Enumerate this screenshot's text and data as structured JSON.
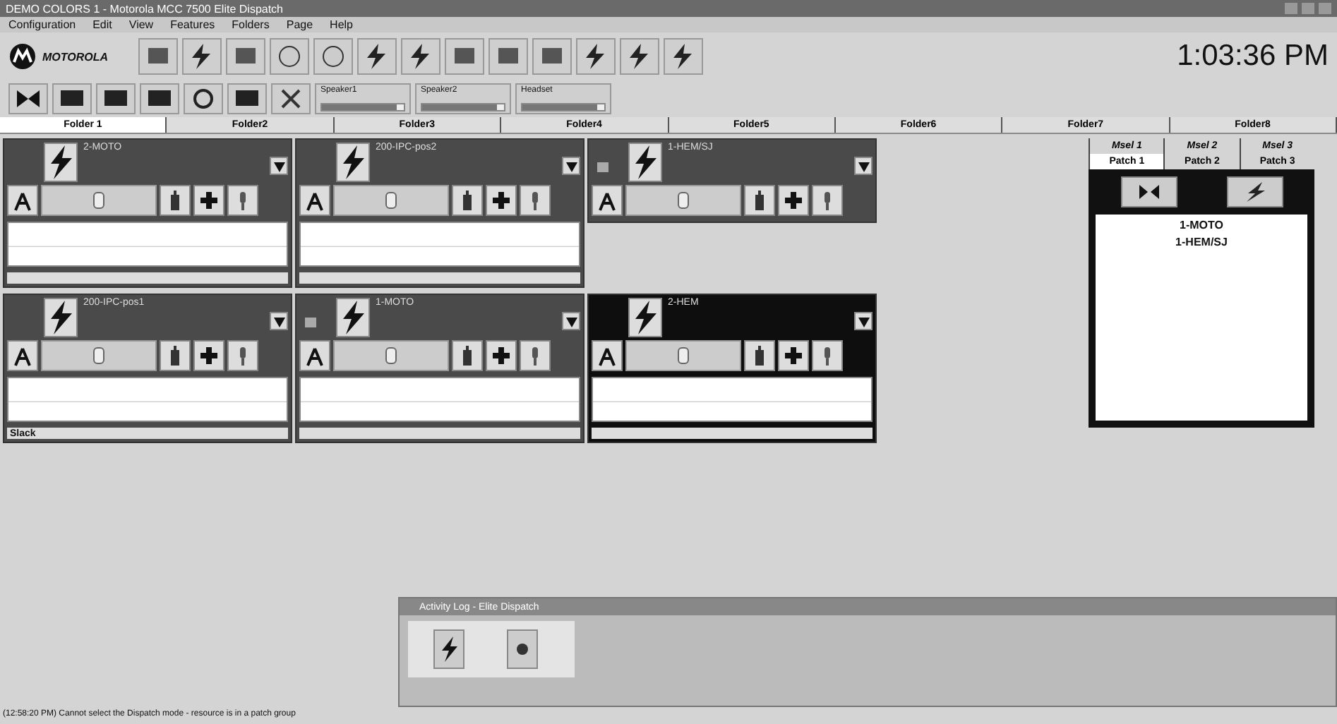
{
  "window": {
    "title": "DEMO COLORS 1 - Motorola MCC 7500 Elite Dispatch"
  },
  "menu": [
    "Configuration",
    "Edit",
    "View",
    "Features",
    "Folders",
    "Page",
    "Help"
  ],
  "brand": "MOTOROLA",
  "clock": "1:03:36 PM",
  "audio_sliders": [
    {
      "label": "Speaker1",
      "level": 0.92
    },
    {
      "label": "Speaker2",
      "level": 0.92
    },
    {
      "label": "Headset",
      "level": 0.92
    }
  ],
  "folders": [
    {
      "label": "Folder 1",
      "selected": true
    },
    {
      "label": "Folder2",
      "selected": false
    },
    {
      "label": "Folder3",
      "selected": false
    },
    {
      "label": "Folder4",
      "selected": false
    },
    {
      "label": "Folder5",
      "selected": false
    },
    {
      "label": "Folder6",
      "selected": false
    },
    {
      "label": "Folder7",
      "selected": false
    },
    {
      "label": "Folder8",
      "selected": false
    }
  ],
  "tiles": [
    {
      "name": "2-MOTO",
      "kind": "full",
      "selected": false,
      "patched": false,
      "level": 0.5
    },
    {
      "name": "200-IPC-pos2",
      "kind": "full",
      "selected": false,
      "patched": false,
      "level": 0.5
    },
    {
      "name": "1-HEM/SJ",
      "kind": "compact",
      "selected": false,
      "patched": true,
      "level": 0.5
    },
    {
      "name": "200-IPC-pos1",
      "kind": "full",
      "selected": false,
      "patched": false,
      "level": 0.5,
      "footer": "Slack"
    },
    {
      "name": "1-MOTO",
      "kind": "full",
      "selected": false,
      "patched": true,
      "level": 0.5
    },
    {
      "name": "2-HEM",
      "kind": "full",
      "selected": true,
      "patched": false,
      "level": 0.5
    }
  ],
  "patch_panel": {
    "msel_tabs": [
      {
        "label": "Msel 1",
        "selected": false
      },
      {
        "label": "Msel 2",
        "selected": false
      },
      {
        "label": "Msel 3",
        "selected": false
      }
    ],
    "patch_tabs": [
      {
        "label": "Patch 1",
        "selected": true
      },
      {
        "label": "Patch 2",
        "selected": false
      },
      {
        "label": "Patch 3",
        "selected": false
      }
    ],
    "members": [
      "1-MOTO",
      "1-HEM/SJ"
    ]
  },
  "activity_log": {
    "title": "Activity Log - Elite Dispatch"
  },
  "status_bar": "(12:58:20 PM) Cannot select the Dispatch mode - resource is in a patch group"
}
